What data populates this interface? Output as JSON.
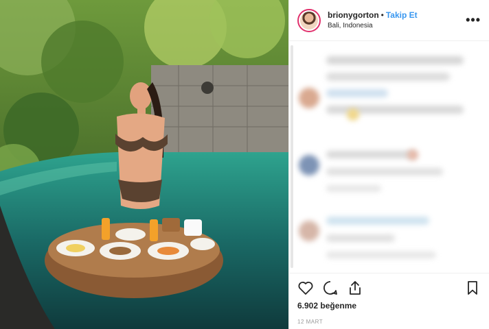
{
  "post": {
    "username": "brionygorton",
    "separator": "•",
    "follow_label": "Takip Et",
    "location": "Bali, Indonesia",
    "more_label": "•••",
    "likes_count": "6.902",
    "likes_label": "beğenme",
    "date": "12 MART"
  },
  "icons": {
    "like": "heart-icon",
    "comment": "comment-icon",
    "share": "share-icon",
    "save": "bookmark-icon",
    "more": "more-options-icon"
  },
  "colors": {
    "follow_blue": "#3897f0",
    "text_dark": "#262626",
    "meta_gray": "#999999",
    "divider": "#efefef"
  }
}
